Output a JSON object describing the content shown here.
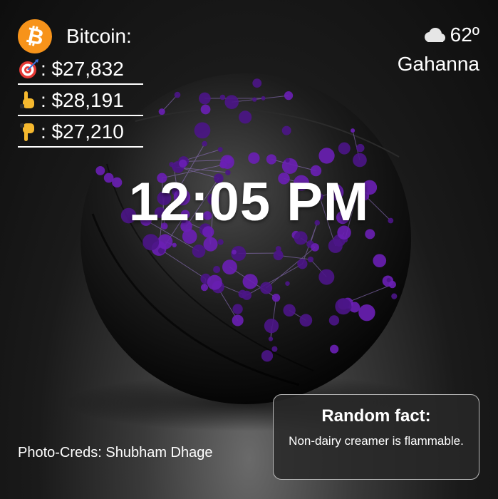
{
  "bitcoin": {
    "title": "Bitcoin:",
    "logo_icon": "bitcoin-icon",
    "rows": [
      {
        "icon": "target-icon",
        "label": ": $27,832"
      },
      {
        "icon": "pointing-up-icon",
        "label": ": $28,191"
      },
      {
        "icon": "pointing-down-icon",
        "label": ": $27,210"
      }
    ]
  },
  "weather": {
    "icon": "cloud-icon",
    "temperature": "62º",
    "city": "Gahanna"
  },
  "clock": {
    "time": "12:05 PM"
  },
  "credits": {
    "text": "Photo-Creds: Shubham Dhage"
  },
  "fact": {
    "title": "Random fact:",
    "body": "Non-dairy creamer is flammable."
  },
  "colors": {
    "bitcoin_orange": "#f7931a",
    "accent_purple": "#6a1fb5",
    "text": "#ffffff"
  }
}
